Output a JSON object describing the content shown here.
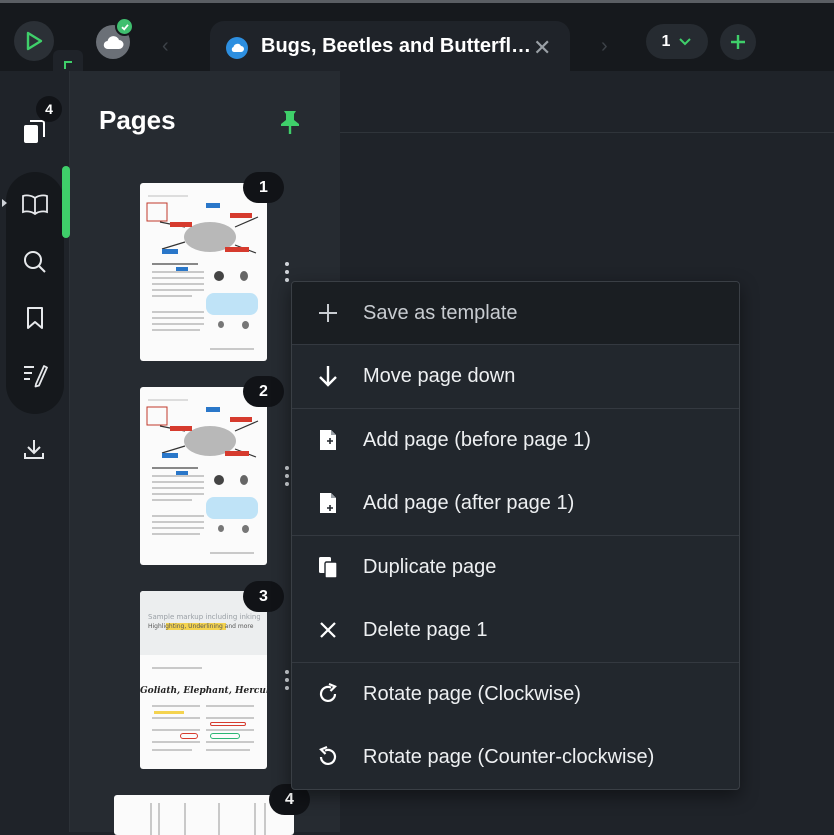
{
  "titlebar": {
    "document_tab_title": "Bugs, Beetles and Butterfl…",
    "tab_count": "1"
  },
  "left_rail": {
    "pages_badge": "4"
  },
  "pages_panel": {
    "title": "Pages",
    "pages": [
      {
        "number": "1"
      },
      {
        "number": "2"
      },
      {
        "number": "3"
      },
      {
        "number": "4"
      }
    ]
  },
  "thumbnails": {
    "page3_heading": "Goliath, Elephant, Hercules",
    "page3_top_line": "Sample markup including inking",
    "page3_tags": "Highlighting, Underlining and more"
  },
  "context_menu": {
    "items": [
      {
        "label": "Save as template",
        "icon": "plus-icon"
      },
      {
        "label": "Move page down",
        "icon": "arrow-down-icon"
      },
      {
        "label": "Add page (before page 1)",
        "icon": "add-page-before-icon"
      },
      {
        "label": "Add page (after page 1)",
        "icon": "add-page-after-icon"
      },
      {
        "label": "Duplicate page",
        "icon": "duplicate-icon"
      },
      {
        "label": "Delete page 1",
        "icon": "close-icon"
      },
      {
        "label": "Rotate page (Clockwise)",
        "icon": "rotate-clockwise-icon"
      },
      {
        "label": "Rotate page (Counter-clockwise)",
        "icon": "rotate-counterclockwise-icon"
      }
    ]
  },
  "colors": {
    "accent": "#3fcf6a",
    "tab_cloud": "#2d8fe0",
    "background": "#1f2329"
  }
}
